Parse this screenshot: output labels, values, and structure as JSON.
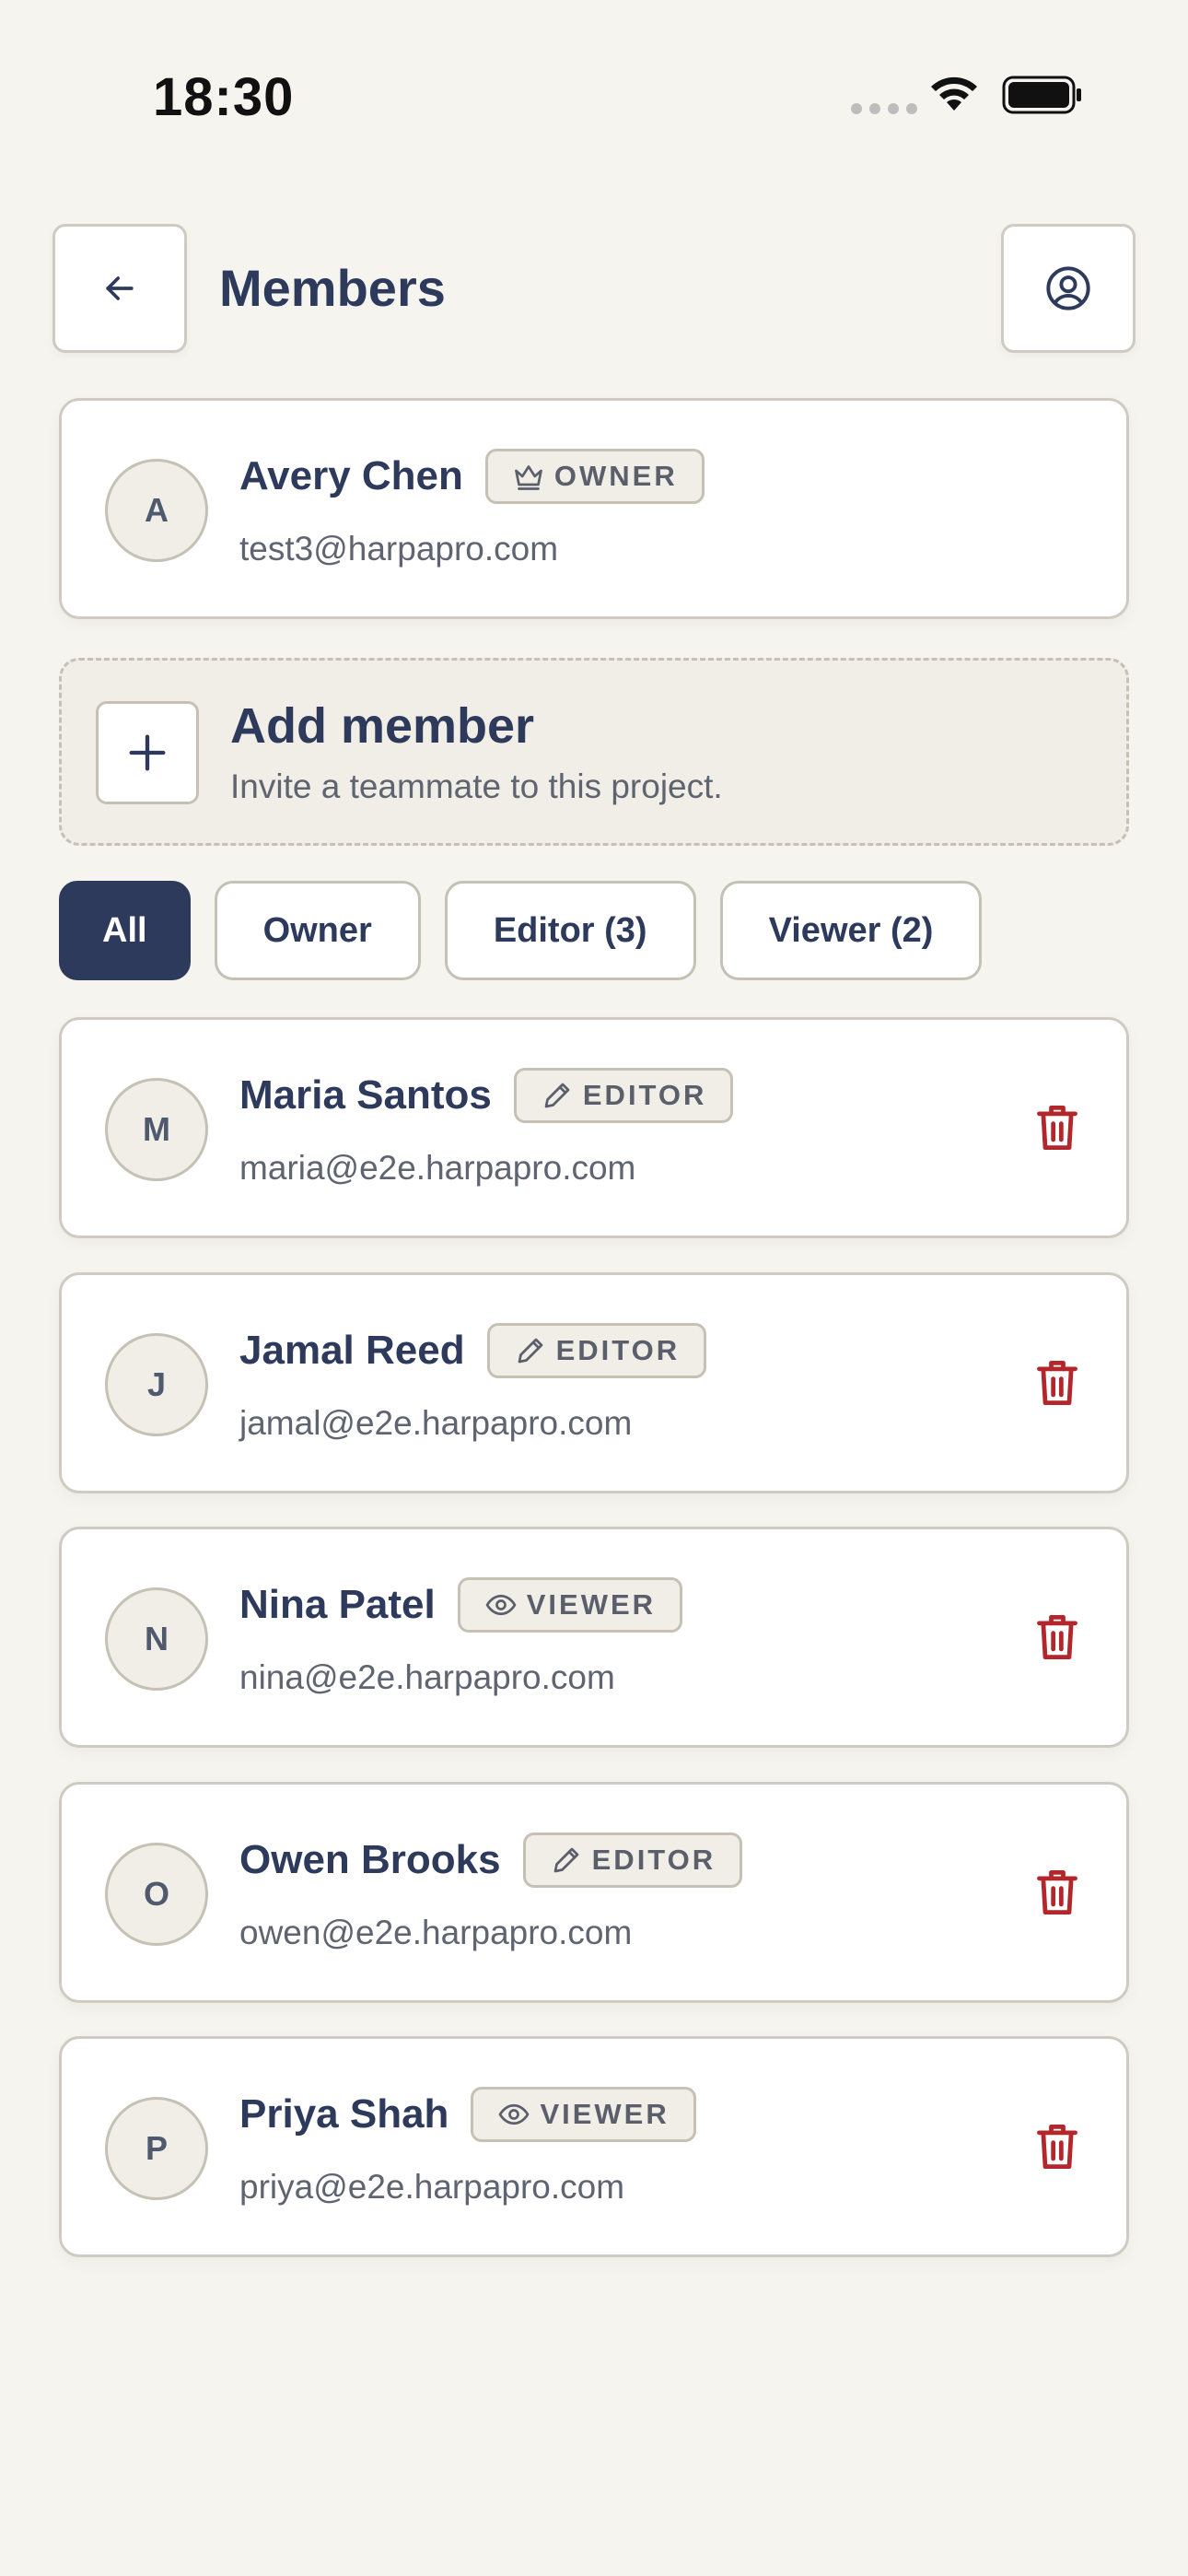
{
  "status_bar": {
    "time": "18:30"
  },
  "header": {
    "title": "Members"
  },
  "owner": {
    "initial": "A",
    "name": "Avery Chen",
    "role": "OWNER",
    "email": "test3@harpapro.com"
  },
  "add_member": {
    "title": "Add member",
    "subtitle": "Invite a teammate to this project."
  },
  "filters": [
    {
      "label": "All",
      "active": true
    },
    {
      "label": "Owner",
      "active": false
    },
    {
      "label": "Editor (3)",
      "active": false
    },
    {
      "label": "Viewer (2)",
      "active": false
    }
  ],
  "members": [
    {
      "initial": "M",
      "name": "Maria Santos",
      "role": "EDITOR",
      "role_icon": "pencil-icon",
      "email": "maria@e2e.harpapro.com"
    },
    {
      "initial": "J",
      "name": "Jamal Reed",
      "role": "EDITOR",
      "role_icon": "pencil-icon",
      "email": "jamal@e2e.harpapro.com"
    },
    {
      "initial": "N",
      "name": "Nina Patel",
      "role": "VIEWER",
      "role_icon": "eye-icon",
      "email": "nina@e2e.harpapro.com"
    },
    {
      "initial": "O",
      "name": "Owen Brooks",
      "role": "EDITOR",
      "role_icon": "pencil-icon",
      "email": "owen@e2e.harpapro.com"
    },
    {
      "initial": "P",
      "name": "Priya Shah",
      "role": "VIEWER",
      "role_icon": "eye-icon",
      "email": "priya@e2e.harpapro.com"
    }
  ],
  "colors": {
    "background": "#f6f4ef",
    "primary": "#2d3a5c",
    "delete": "#b3262b",
    "badge_bg": "#f1eee7"
  }
}
